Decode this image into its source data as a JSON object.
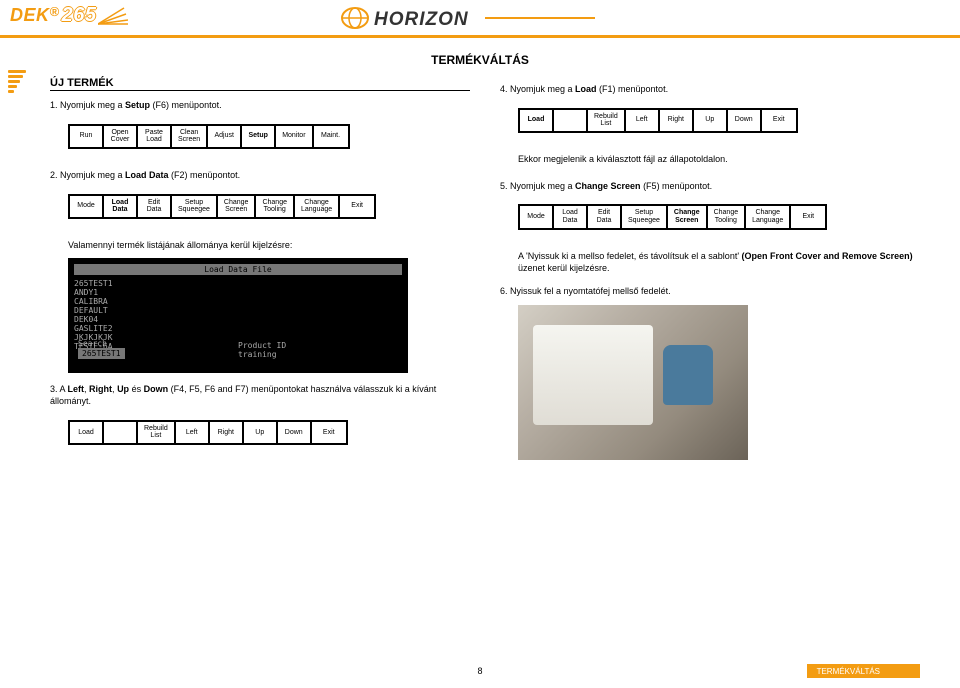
{
  "header": {
    "brand1": "DEK",
    "brand1_suffix": "265",
    "brand2": "HORIZON"
  },
  "page_title": "TERMÉKVÁLTÁS",
  "left": {
    "title": "ÚJ TERMÉK",
    "step1": "1.  Nyomjuk meg a ",
    "step1_b": "Setup",
    "step1_end": " (F6) menüpontot.",
    "menubar1": [
      "Run",
      "Open Cover",
      "Paste Load",
      "Clean Screen",
      "Adjust",
      "Setup",
      "Monitor",
      "Maint."
    ],
    "menubar1_bold_index": 5,
    "step2": "2.  Nyomjuk meg a ",
    "step2_b": "Load Data",
    "step2_end": " (F2) menüpontot.",
    "menubar2": [
      "Mode",
      "Load Data",
      "Edit Data",
      "Setup Squeegee",
      "Change Screen",
      "Change Tooling",
      "Change Language",
      "Exit"
    ],
    "menubar2_bold_index": 1,
    "caption1": "Valamennyi termék listájának állománya kerül kijelzésre:",
    "screenshot": {
      "title": "Load Data File",
      "lines": [
        "265TEST1",
        "ANDY1",
        "CALIBRA",
        "DEFAULT",
        "DEK04",
        "GASLITE2",
        "JKJKJKJK",
        "TESTE-6A"
      ],
      "search_label": "Search",
      "search_val": "265TEST1",
      "product_label": "Product ID",
      "product_val": "training"
    },
    "step3": "3.  A ",
    "step3_b1": "Left",
    "step3_mid1": ", ",
    "step3_b2": "Right",
    "step3_mid2": ", ",
    "step3_b3": "Up",
    "step3_mid3": " és ",
    "step3_b4": "Down",
    "step3_end": " (F4, F5, F6 and F7) menüpontokat használva válasszuk ki a kívánt állományt.",
    "menubar3": [
      "Load",
      "",
      "Rebuild List",
      "Left",
      "Right",
      "Up",
      "Down",
      "Exit"
    ]
  },
  "right": {
    "step4": "4.  Nyomjuk meg a ",
    "step4_b": "Load",
    "step4_end": " (F1) menüpontot.",
    "menubar4": [
      "Load",
      "",
      "Rebuild List",
      "Left",
      "Right",
      "Up",
      "Down",
      "Exit"
    ],
    "menubar4_bold_index": 0,
    "note1": "Ekkor megjelenik a kiválasztott fájl az állapotoldalon.",
    "step5": "5.  Nyomjuk meg a ",
    "step5_b": "Change Screen",
    "step5_end": " (F5) menüpontot.",
    "menubar5": [
      "Mode",
      "Load Data",
      "Edit Data",
      "Setup Squeegee",
      "Change Screen",
      "Change Tooling",
      "Change Language",
      "Exit"
    ],
    "menubar5_bold_index": 4,
    "note2a": "A 'Nyissuk ki a mellso fedelet, és távolítsuk el a sablont' ",
    "note2b": "(Open Front Cover and Remove Screen)",
    "note2c": " üzenet kerül kijelzésre.",
    "step6": "6.  Nyissuk fel a nyomtatófej mellső fedelét."
  },
  "footer": {
    "page": "8",
    "label": "TERMÉKVÁLTÁS"
  }
}
